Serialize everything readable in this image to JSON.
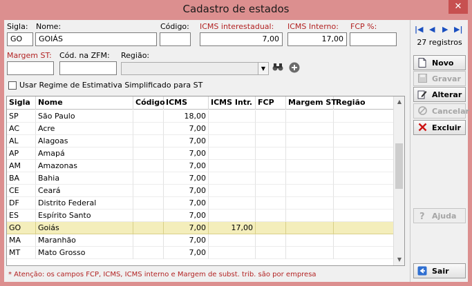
{
  "window": {
    "title": "Cadastro de estados",
    "close_glyph": "✕"
  },
  "form": {
    "sigla": {
      "label": "Sigla:",
      "value": "GO"
    },
    "nome": {
      "label": "Nome:",
      "value": "GOIÁS"
    },
    "codigo": {
      "label": "Código:",
      "value": ""
    },
    "icms_interestadual": {
      "label": "ICMS interestadual:",
      "value": "7,00"
    },
    "icms_interno": {
      "label": "ICMS Interno:",
      "value": "17,00"
    },
    "fcp": {
      "label": "FCP %:",
      "value": ""
    },
    "margem_st": {
      "label": "Margem ST:",
      "value": ""
    },
    "cod_zfm": {
      "label": "Cód. na ZFM:",
      "value": ""
    },
    "regiao": {
      "label": "Região:",
      "value": ""
    },
    "regime_checkbox": {
      "label": "Usar Regime de Estimativa Simplificado para ST",
      "checked": false
    }
  },
  "grid": {
    "columns": [
      "Sigla",
      "Nome",
      "Código",
      "ICMS",
      "ICMS Intr.",
      "FCP",
      "Margem ST",
      "Região"
    ],
    "rows": [
      [
        "SP",
        "São Paulo",
        "",
        "18,00",
        "",
        "",
        "",
        ""
      ],
      [
        "AC",
        "Acre",
        "",
        "7,00",
        "",
        "",
        "",
        ""
      ],
      [
        "AL",
        "Alagoas",
        "",
        "7,00",
        "",
        "",
        "",
        ""
      ],
      [
        "AP",
        "Amapá",
        "",
        "7,00",
        "",
        "",
        "",
        ""
      ],
      [
        "AM",
        "Amazonas",
        "",
        "7,00",
        "",
        "",
        "",
        ""
      ],
      [
        "BA",
        "Bahia",
        "",
        "7,00",
        "",
        "",
        "",
        ""
      ],
      [
        "CE",
        "Ceará",
        "",
        "7,00",
        "",
        "",
        "",
        ""
      ],
      [
        "DF",
        "Distrito Federal",
        "",
        "7,00",
        "",
        "",
        "",
        ""
      ],
      [
        "ES",
        "Espírito Santo",
        "",
        "7,00",
        "",
        "",
        "",
        ""
      ],
      [
        "GO",
        "Goiás",
        "",
        "7,00",
        "17,00",
        "",
        "",
        ""
      ],
      [
        "MA",
        "Maranhão",
        "",
        "7,00",
        "",
        "",
        "",
        ""
      ],
      [
        "MT",
        "Mato Grosso",
        "",
        "7,00",
        "",
        "",
        "",
        ""
      ]
    ],
    "selected_index": 9
  },
  "note": "* Atenção: os campos FCP, ICMS, ICMS interno e Margem de subst. trib. são por empresa",
  "sidebar": {
    "nav": {
      "first": "|◀",
      "prev": "◀",
      "next": "▶",
      "last": "▶|"
    },
    "record_count": "27 registros",
    "buttons": {
      "novo": "Novo",
      "gravar": "Gravar",
      "alterar": "Alterar",
      "cancelar": "Cancelar",
      "excluir": "Excluir",
      "ajuda": "Ajuda",
      "sair": "Sair"
    }
  },
  "colors": {
    "titlebar": "#dc8f8f",
    "accent_red": "#b22222",
    "selected_row": "#f4eebb",
    "close_button": "#c75050"
  }
}
